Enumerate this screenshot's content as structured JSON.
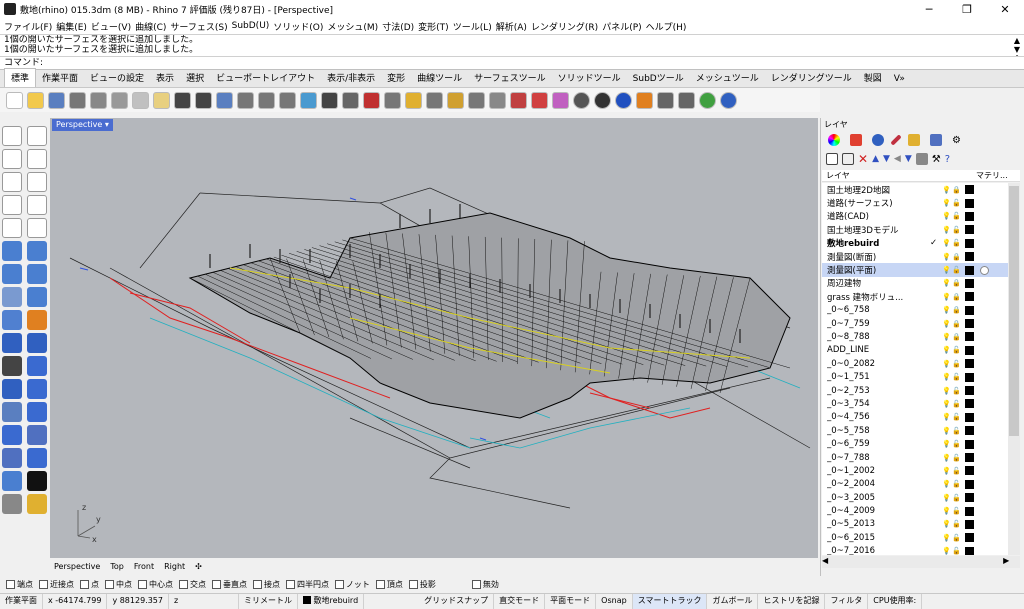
{
  "window": {
    "title": "敷地(rhino) 015.3dm (8 MB) - Rhino 7 評価版 (残り87日) - [Perspective]",
    "minimize": "─",
    "maximize": "❐",
    "close": "✕"
  },
  "menu": [
    "ファイル(F)",
    "編集(E)",
    "ビュー(V)",
    "曲線(C)",
    "サーフェス(S)",
    "SubD(U)",
    "ソリッド(O)",
    "メッシュ(M)",
    "寸法(D)",
    "変形(T)",
    "ツール(L)",
    "解析(A)",
    "レンダリング(R)",
    "パネル(P)",
    "ヘルプ(H)"
  ],
  "history": [
    "1個の開いたサーフェスを選択に追加しました。",
    "1個の開いたサーフェスを選択に追加しました。"
  ],
  "command": {
    "label": "コマンド:"
  },
  "tabs": [
    "標準",
    "作業平面",
    "ビューの設定",
    "表示",
    "選択",
    "ビューポートレイアウト",
    "表示/非表示",
    "変形",
    "曲線ツール",
    "サーフェスツール",
    "ソリッドツール",
    "SubDツール",
    "メッシュツール",
    "レンダリングツール",
    "製図",
    "V»"
  ],
  "viewport": {
    "name": "Perspective",
    "tabs": [
      "Perspective",
      "Top",
      "Front",
      "Right"
    ],
    "add_icon": "plus-icon",
    "axis": {
      "x": "x",
      "y": "y",
      "z": "z"
    }
  },
  "osnap": [
    {
      "label": "端点",
      "checked": false
    },
    {
      "label": "近接点",
      "checked": false
    },
    {
      "label": "点",
      "checked": false
    },
    {
      "label": "中点",
      "checked": false
    },
    {
      "label": "中心点",
      "checked": false
    },
    {
      "label": "交点",
      "checked": false
    },
    {
      "label": "垂直点",
      "checked": false
    },
    {
      "label": "接点",
      "checked": false
    },
    {
      "label": "四半円点",
      "checked": false
    },
    {
      "label": "ノット",
      "checked": false
    },
    {
      "label": "頂点",
      "checked": false
    },
    {
      "label": "投影",
      "checked": false
    },
    {
      "label": "無効",
      "checked": false
    }
  ],
  "status": {
    "plane": "作業平面",
    "x": "x -64174.799",
    "y": "y 88129.357",
    "z": "z",
    "unit": "ミリメートル",
    "layer": "敷地rebuird",
    "grid": "グリッドスナップ",
    "ortho": "直交モード",
    "planar": "平面モード",
    "osnap": "Osnap",
    "smart": "スマートトラック",
    "gumball": "ガムボール",
    "history": "ヒストリを記録",
    "filter": "フィルタ",
    "cpu": "CPU使用率:"
  },
  "panel": {
    "title": "レイヤ",
    "column_layer": "レイヤ",
    "column_material": "マテリ...",
    "layers": [
      {
        "name": "国土地理2D地図",
        "lit": false,
        "locked": true
      },
      {
        "name": "道路(サーフェス)",
        "lit": false,
        "locked": false
      },
      {
        "name": "道路(CAD)",
        "lit": false,
        "locked": false
      },
      {
        "name": "国土地理3Dモデル",
        "lit": false,
        "locked": false
      },
      {
        "name": "敷地rebuird",
        "lit": true,
        "locked": false,
        "current": true
      },
      {
        "name": "測量図(断面)",
        "lit": false,
        "locked": true
      },
      {
        "name": "測量図(平面)",
        "lit": true,
        "locked": false,
        "selected": true
      },
      {
        "name": "周辺建物",
        "lit": false,
        "locked": true
      },
      {
        "name": "grass 建物ボリュ...",
        "lit": false,
        "locked": true
      },
      {
        "name": "_0~6_758",
        "lit": false,
        "locked": true
      },
      {
        "name": "_0~7_759",
        "lit": false,
        "locked": true
      },
      {
        "name": "_0~8_788",
        "lit": false,
        "locked": true
      },
      {
        "name": "ADD_LINE",
        "lit": true,
        "locked": false
      },
      {
        "name": "_0~0_2082",
        "lit": true,
        "locked": false
      },
      {
        "name": "_0~1_751",
        "lit": true,
        "locked": false
      },
      {
        "name": "_0~2_753",
        "lit": true,
        "locked": false
      },
      {
        "name": "_0~3_754",
        "lit": true,
        "locked": false
      },
      {
        "name": "_0~4_756",
        "lit": true,
        "locked": false
      },
      {
        "name": "_0~5_758",
        "lit": true,
        "locked": false
      },
      {
        "name": "_0~6_759",
        "lit": true,
        "locked": false
      },
      {
        "name": "_0~7_788",
        "lit": true,
        "locked": false
      },
      {
        "name": "_0~1_2002",
        "lit": true,
        "locked": false
      },
      {
        "name": "_0~2_2004",
        "lit": true,
        "locked": false
      },
      {
        "name": "_0~3_2005",
        "lit": true,
        "locked": false
      },
      {
        "name": "_0~4_2009",
        "lit": true,
        "locked": false
      },
      {
        "name": "_0~5_2013",
        "lit": true,
        "locked": false
      },
      {
        "name": "_0~6_2015",
        "lit": true,
        "locked": false
      },
      {
        "name": "_0~7_2016",
        "lit": true,
        "locked": false
      }
    ]
  },
  "colors": {
    "viewport_bg": "#b4b7bc",
    "selected_tab": "#4a6cd0",
    "layer_selected": "#c7d6f5"
  }
}
